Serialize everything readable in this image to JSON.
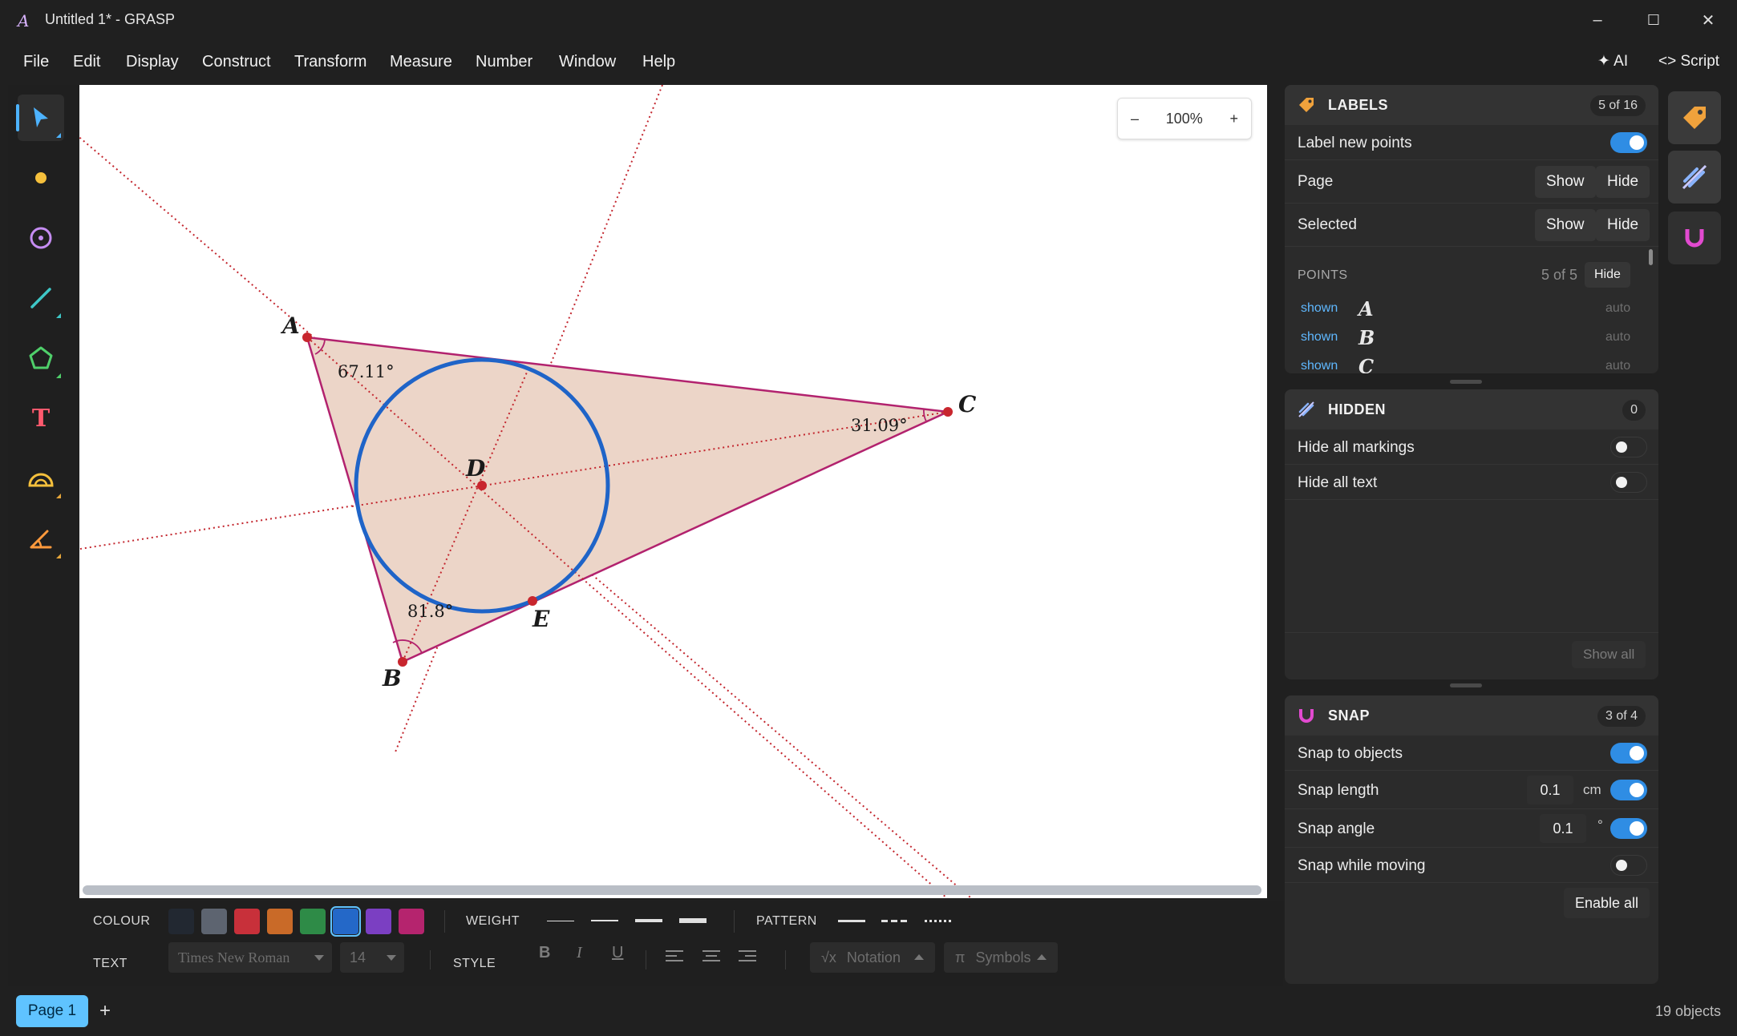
{
  "window": {
    "title": "Untitled 1* - GRASP",
    "minimize": "–",
    "maximize": "☐",
    "close": "✕"
  },
  "menu": {
    "items": [
      "File",
      "Edit",
      "Display",
      "Construct",
      "Transform",
      "Measure",
      "Number",
      "Window",
      "Help"
    ],
    "ai_label": "AI",
    "script_label": "Script"
  },
  "tools": [
    {
      "name": "select-tool",
      "icon": "arrow-pointer-icon",
      "active": true
    },
    {
      "name": "point-tool",
      "icon": "point-dot-icon"
    },
    {
      "name": "circle-tool",
      "icon": "circle-icon"
    },
    {
      "name": "line-tool",
      "icon": "segment-icon"
    },
    {
      "name": "polygon-tool",
      "icon": "pentagon-icon"
    },
    {
      "name": "text-tool",
      "icon": "text-t-icon"
    },
    {
      "name": "arc-tool",
      "icon": "semicircle-icon"
    },
    {
      "name": "angle-tool",
      "icon": "angle-icon"
    }
  ],
  "canvas": {
    "zoom": "100%",
    "zoom_out": "–",
    "zoom_in": "+",
    "labels": {
      "A": "A",
      "B": "B",
      "C": "C",
      "D": "D",
      "E": "E"
    },
    "angles": {
      "A": "67.11°",
      "B": "81.8°",
      "C": "31.09°"
    },
    "colors": {
      "fill": "#ecd5c8",
      "edge": "#b2226e",
      "circle": "#1f64c8",
      "point": "#c8262e",
      "dotted": "#c3262e"
    }
  },
  "format": {
    "colour_label": "COLOUR",
    "swatches": [
      "#222831",
      "#5d6470",
      "#c8303a",
      "#c96a28",
      "#2e8b47",
      "#2468c8",
      "#7b3fc2",
      "#b5246e"
    ],
    "weight_label": "WEIGHT",
    "pattern_label": "PATTERN",
    "text_label": "TEXT",
    "font_value": "Times New Roman",
    "size_value": "14",
    "style_label": "STYLE",
    "bold": "B",
    "italic": "I",
    "underline": "U",
    "notation": "Notation",
    "notation_glyph": "√x",
    "symbols": "Symbols",
    "symbols_glyph": "π"
  },
  "status": {
    "page_tab": "Page 1",
    "add_page": "+",
    "objects": "19 objects"
  },
  "labels_panel": {
    "title": "LABELS",
    "badge": "5 of 16",
    "label_new_points": "Label new points",
    "page": "Page",
    "selected": "Selected",
    "show": "Show",
    "hide": "Hide",
    "points_title": "POINTS",
    "points_count": "5 of 5",
    "points_hide": "Hide",
    "points": [
      {
        "state": "shown",
        "name": "A",
        "mode": "auto"
      },
      {
        "state": "shown",
        "name": "B",
        "mode": "auto"
      },
      {
        "state": "shown",
        "name": "C",
        "mode": "auto"
      }
    ]
  },
  "hidden_panel": {
    "title": "HIDDEN",
    "badge": "0",
    "hide_markings": "Hide all markings",
    "hide_text": "Hide all text",
    "show_all": "Show all"
  },
  "snap_panel": {
    "title": "SNAP",
    "badge": "3 of 4",
    "snap_objects": "Snap to objects",
    "snap_length": "Snap length",
    "snap_length_value": "0.1",
    "snap_length_unit": "cm",
    "snap_angle": "Snap angle",
    "snap_angle_value": "0.1",
    "snap_angle_unit": "°",
    "snap_moving": "Snap while moving",
    "enable_all": "Enable all"
  }
}
